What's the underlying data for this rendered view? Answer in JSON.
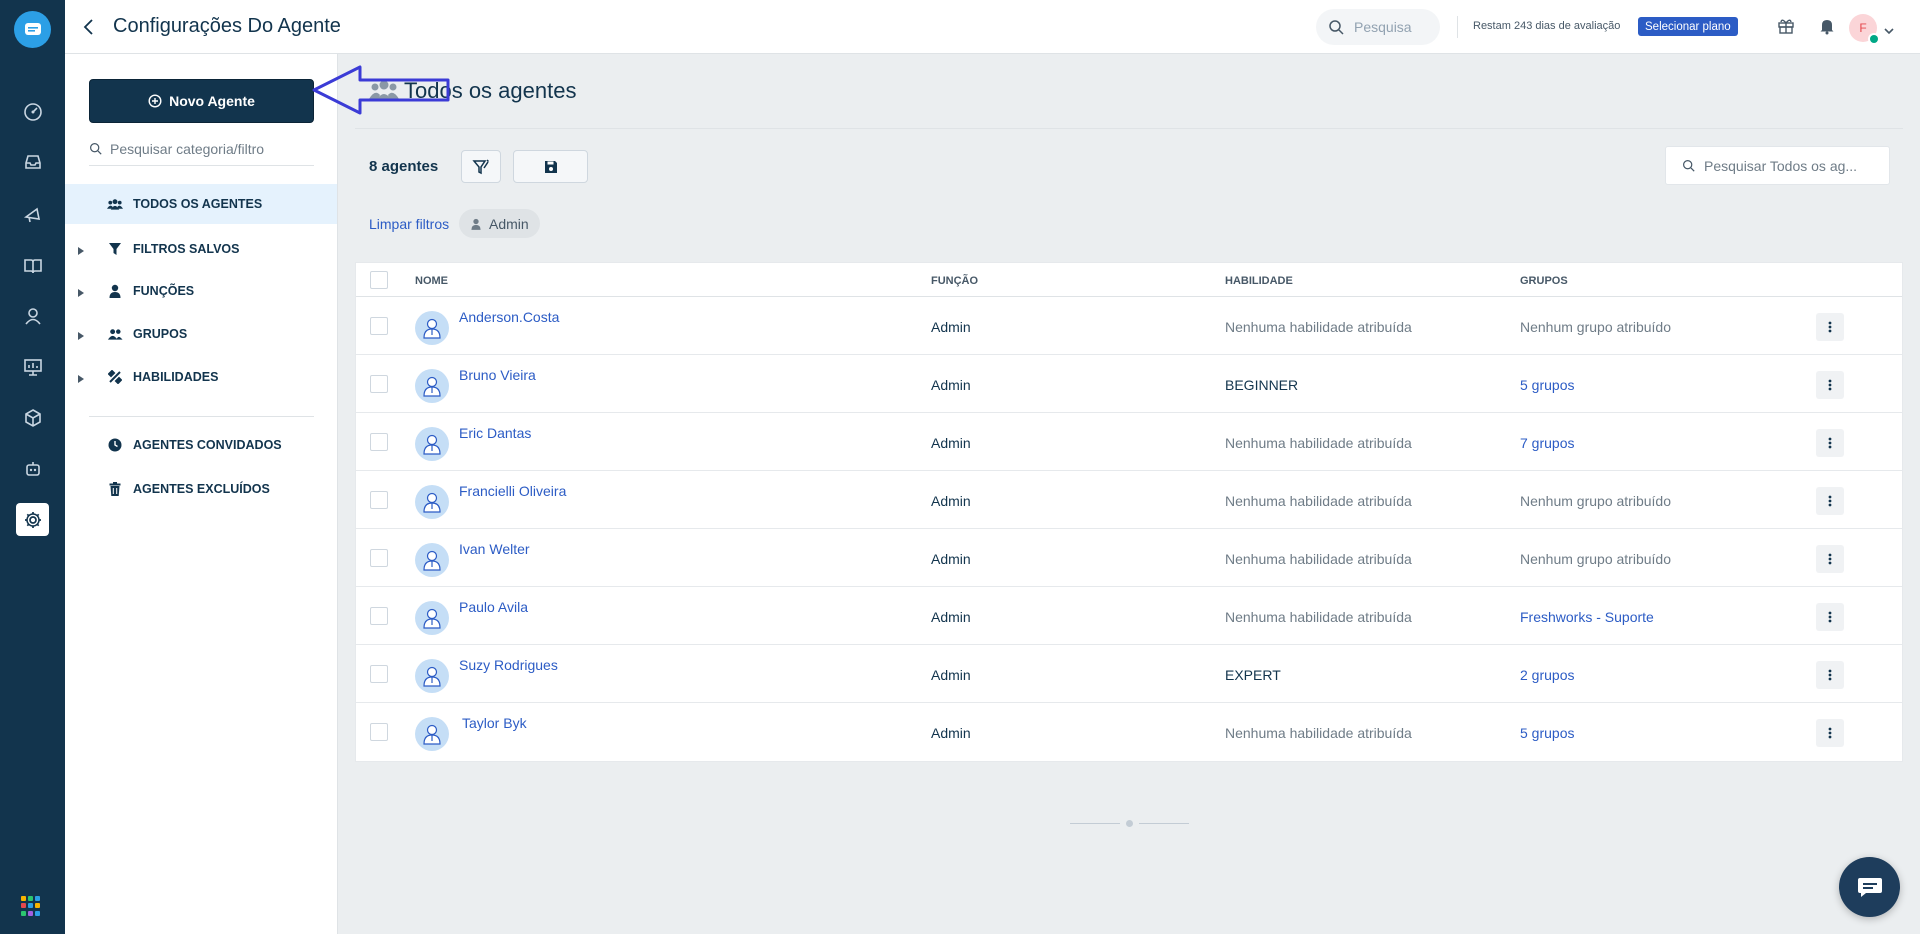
{
  "header": {
    "title": "Configurações Do Agente",
    "search_placeholder": "Pesquisa",
    "trial_text": "Restam 243 dias de avaliação",
    "plan_button": "Selecionar plano",
    "avatar_initial": "F"
  },
  "sidebar": {
    "new_agent_label": "Novo Agente",
    "search_placeholder": "Pesquisar categoria/filtro",
    "items": [
      {
        "label": "Todos os agentes",
        "icon": "users-icon",
        "active": true
      },
      {
        "label": "Filtros salvos",
        "icon": "filter-icon"
      },
      {
        "label": "Funções",
        "icon": "user-icon"
      },
      {
        "label": "Grupos",
        "icon": "users-icon"
      },
      {
        "label": "Habilidades",
        "icon": "tools-icon"
      },
      {
        "label": "Agentes convidados",
        "icon": "clock-icon"
      },
      {
        "label": "Agentes excluídos",
        "icon": "trash-icon"
      }
    ]
  },
  "main": {
    "title": "Todos os agentes",
    "count": "8 agentes",
    "search_placeholder": "Pesquisar Todos os ag...",
    "clear_filters": "Limpar filtros",
    "filter_chip": "Admin"
  },
  "table": {
    "columns": [
      "Nome",
      "Função",
      "Habilidade",
      "Grupos"
    ],
    "rows": [
      {
        "name": "Anderson.Costa",
        "role": "Admin",
        "skill": "Nenhuma habilidade atribuída",
        "groups": "Nenhum grupo atribuído"
      },
      {
        "name": "Bruno Vieira",
        "role": "Admin",
        "skill": "BEGINNER",
        "groups": "5 grupos"
      },
      {
        "name": "Eric Dantas",
        "role": "Admin",
        "skill": "Nenhuma habilidade atribuída",
        "groups": "7 grupos"
      },
      {
        "name": "Francielli Oliveira",
        "role": "Admin",
        "skill": "Nenhuma habilidade atribuída",
        "groups": "Nenhum grupo atribuído"
      },
      {
        "name": "Ivan Welter",
        "role": "Admin",
        "skill": "Nenhuma habilidade atribuída",
        "groups": "Nenhum grupo atribuído"
      },
      {
        "name": "Paulo Avila",
        "role": "Admin",
        "skill": "Nenhuma habilidade atribuída",
        "groups": "Freshworks - Suporte"
      },
      {
        "name": "Suzy Rodrigues",
        "role": "Admin",
        "skill": "EXPERT",
        "groups": "2 grupos"
      },
      {
        "name": "Taylor Byk",
        "role": "Admin",
        "skill": "Nenhuma habilidade atribuída",
        "groups": "5 grupos"
      }
    ]
  },
  "colors": {
    "rail": "#12344d",
    "accent": "#2c5cc5",
    "annotation_arrow": "#3b3bd6"
  }
}
